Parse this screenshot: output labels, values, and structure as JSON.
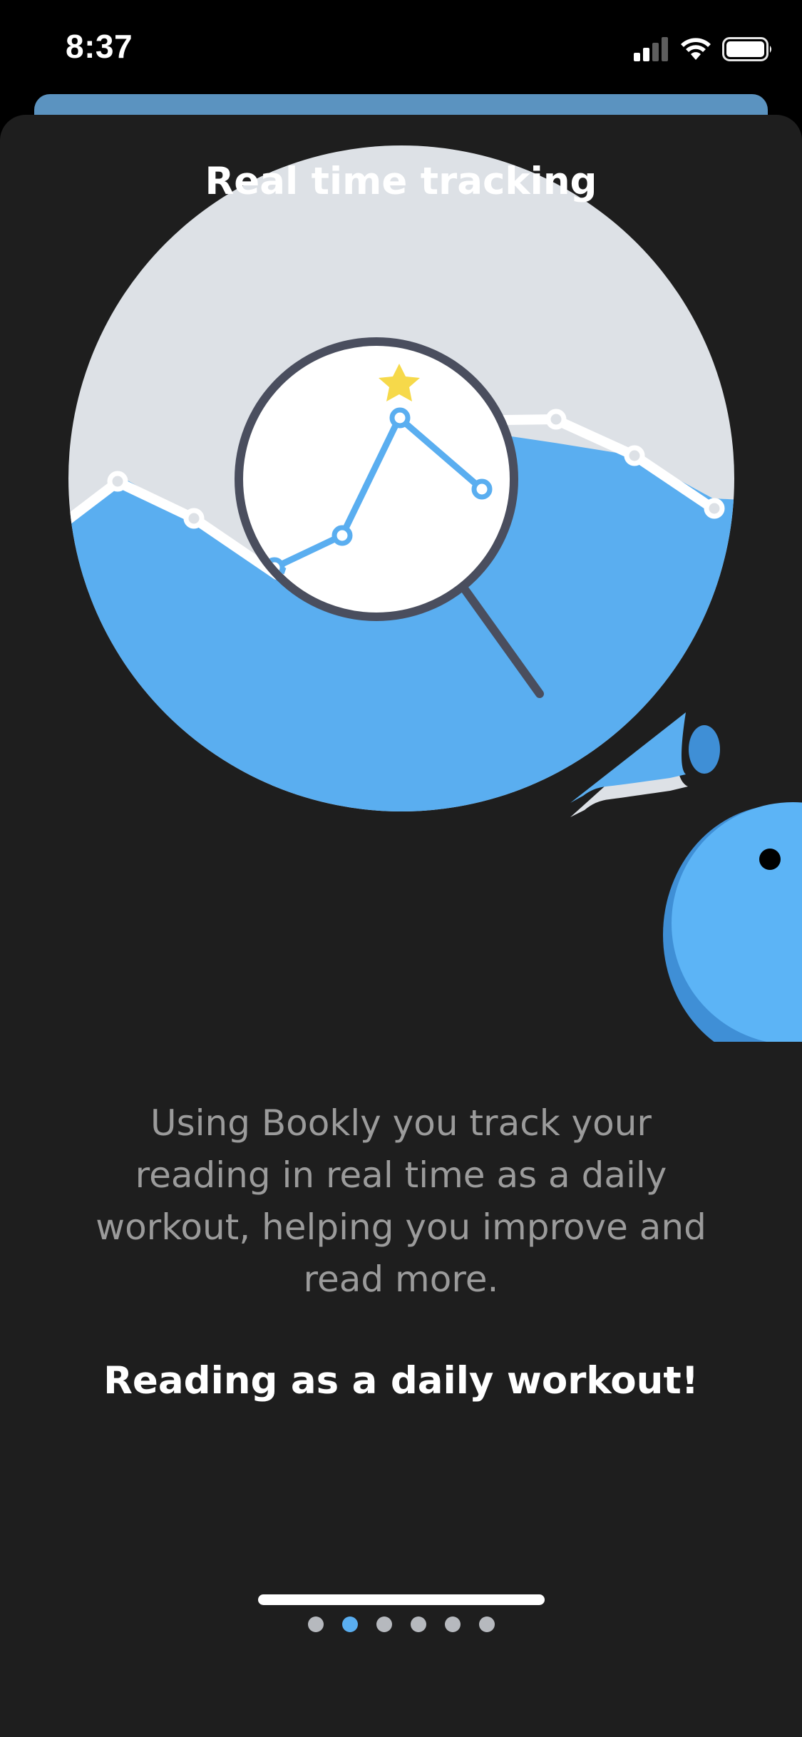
{
  "status_bar": {
    "time": "8:37",
    "icons": [
      "cellular-signal-icon",
      "wifi-icon",
      "battery-icon"
    ]
  },
  "onboarding": {
    "title": "Real time tracking",
    "description": "Using Bookly you track your reading in real time as a daily workout, helping you improve and read more.",
    "tagline": "Reading as a daily workout!",
    "illustration": "magnifier-over-reading-chart-illustration"
  },
  "pager": {
    "total_pages": 6,
    "current_page": 2
  },
  "colors": {
    "background": "#1e1e1e",
    "accent_blue": "#5aaef0",
    "pale_gray": "#dde1e6",
    "dark_outline": "#4a4e5e",
    "star_yellow": "#f6d94a"
  }
}
